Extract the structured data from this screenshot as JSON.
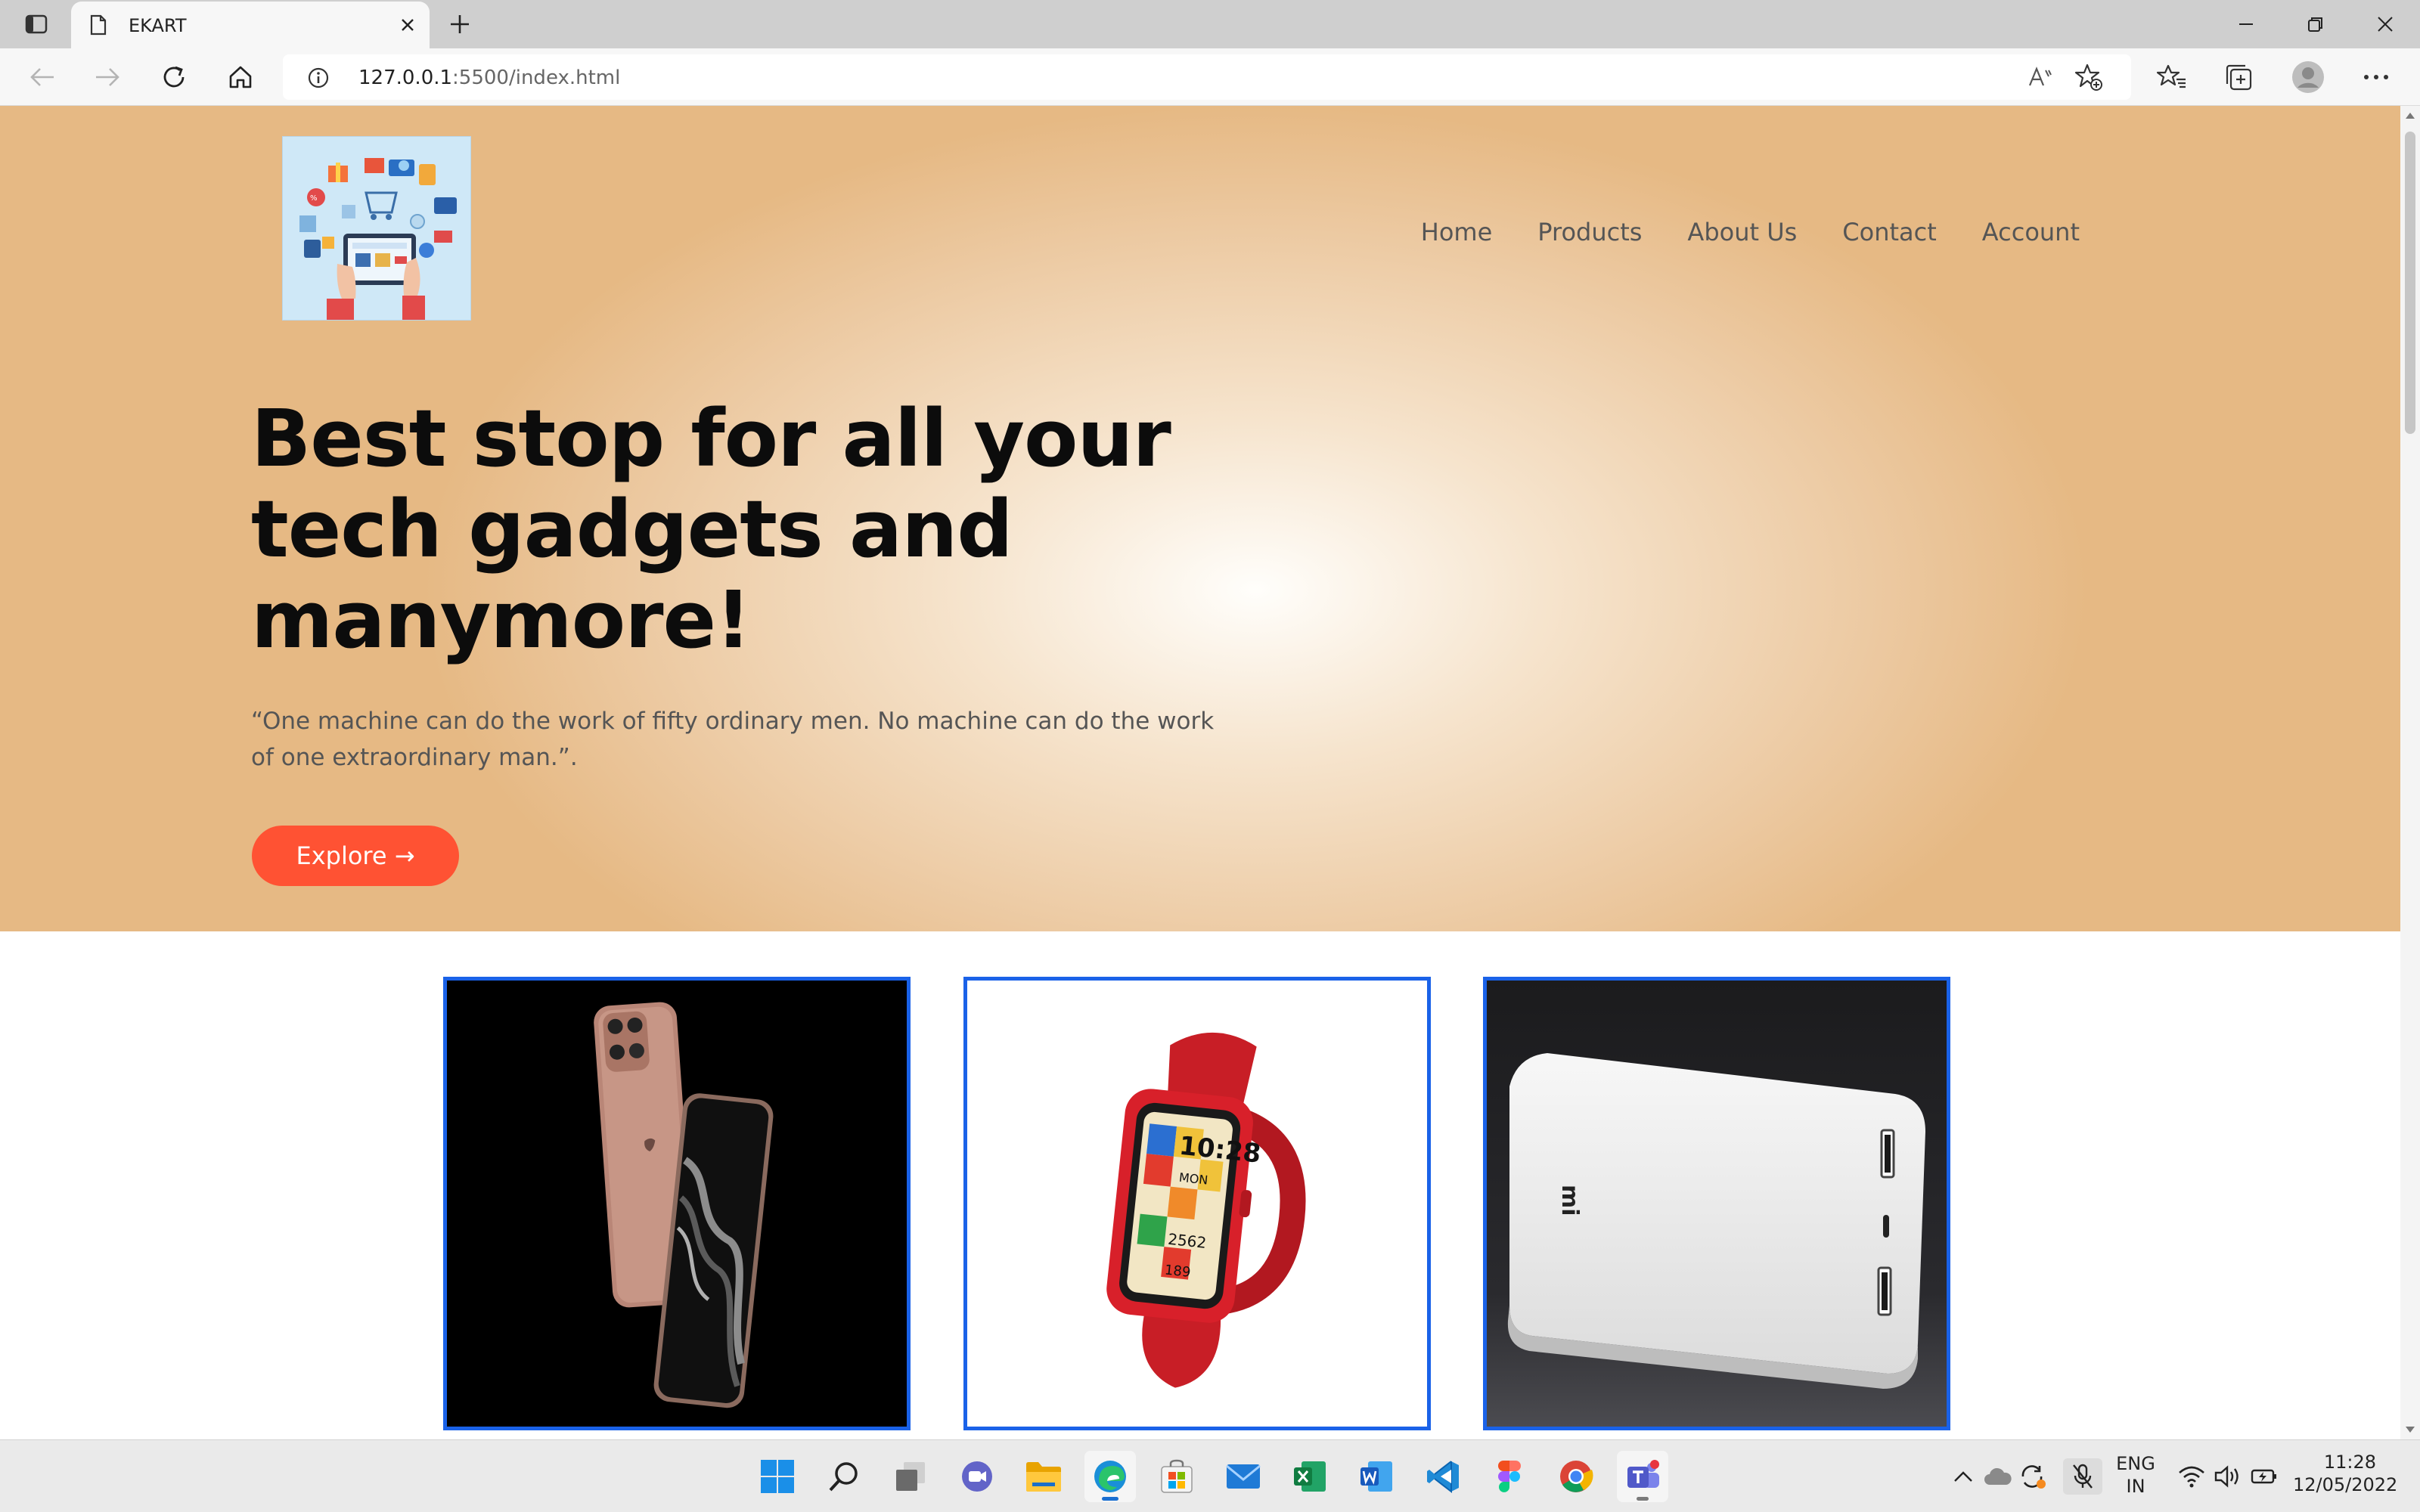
{
  "browser": {
    "tab_title": "EKART",
    "url_host": "127.0.0.1",
    "url_path": ":5500/index.html"
  },
  "site": {
    "nav": [
      {
        "label": "Home"
      },
      {
        "label": "Products"
      },
      {
        "label": "About Us"
      },
      {
        "label": "Contact"
      },
      {
        "label": "Account"
      }
    ],
    "hero_title": "Best stop for all your tech gadgets and manymore!",
    "hero_quote": "“One machine can do the work of fifty ordinary men. No machine can do the work of one extraordinary man.”.",
    "explore_label": "Explore →",
    "accent_color": "#ff5233",
    "card_border_color": "#1a62e8",
    "products": [
      {
        "name": "phone-card",
        "watch_time": ""
      },
      {
        "name": "smartwatch-card",
        "watch_time": "10:28",
        "watch_day": "MON",
        "watch_steps": "2562",
        "watch_hr": "189",
        "watch_color": "#d8202a"
      },
      {
        "name": "powerbank-card",
        "brand_mark": "mi"
      }
    ]
  },
  "taskbar": {
    "apps": [
      "windows-start",
      "search",
      "task-view",
      "teams-chat",
      "file-explorer",
      "edge",
      "microsoft-store",
      "mail",
      "excel",
      "word",
      "vscode",
      "figma",
      "chrome",
      "teams"
    ],
    "language": "ENG",
    "region": "IN",
    "time": "11:28",
    "date": "12/05/2022"
  }
}
